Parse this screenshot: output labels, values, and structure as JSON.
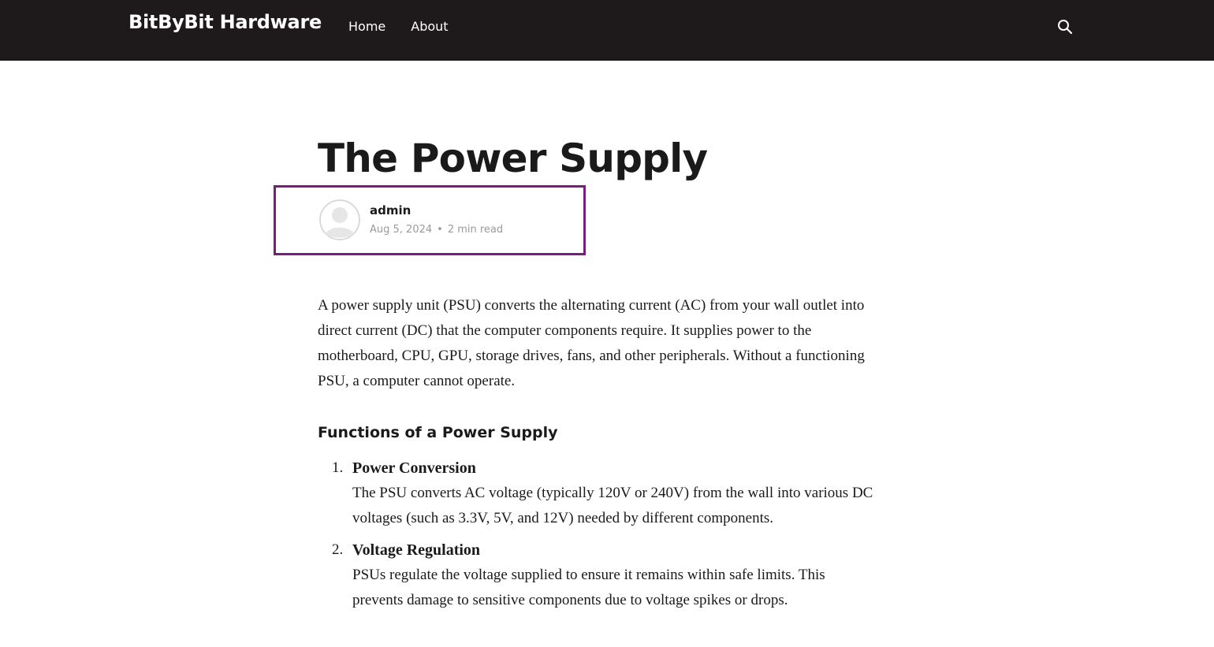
{
  "site": {
    "brand": "BitByBit Hardware",
    "nav": [
      "Home",
      "About"
    ],
    "search_icon": "search-icon"
  },
  "post": {
    "title": "The Power Supply",
    "author": "admin",
    "date": "Aug 5, 2024",
    "separator": "•",
    "read_time": "2 min read",
    "intro": "A power supply unit (PSU) converts the alternating current (AC) from your wall outlet into direct current (DC) that the computer components require. It supplies power to the motherboard, CPU, GPU, storage drives, fans, and other peripherals. Without a functioning PSU, a computer cannot operate.",
    "section_heading": "Functions of a Power Supply",
    "functions": [
      {
        "number": "1.",
        "title": "Power Conversion",
        "desc": "The PSU converts AC voltage (typically 120V or 240V) from the wall into various DC voltages (such as 3.3V, 5V, and 12V) needed by different components."
      },
      {
        "number": "2.",
        "title": "Voltage Regulation",
        "desc": "PSUs regulate the voltage supplied to ensure it remains within safe limits. This prevents damage to sensitive components due to voltage spikes or drops."
      }
    ]
  },
  "colors": {
    "header_bg": "#1e1a1b",
    "highlight_border": "#7a1a82",
    "meta_text": "#9a9a9a"
  }
}
